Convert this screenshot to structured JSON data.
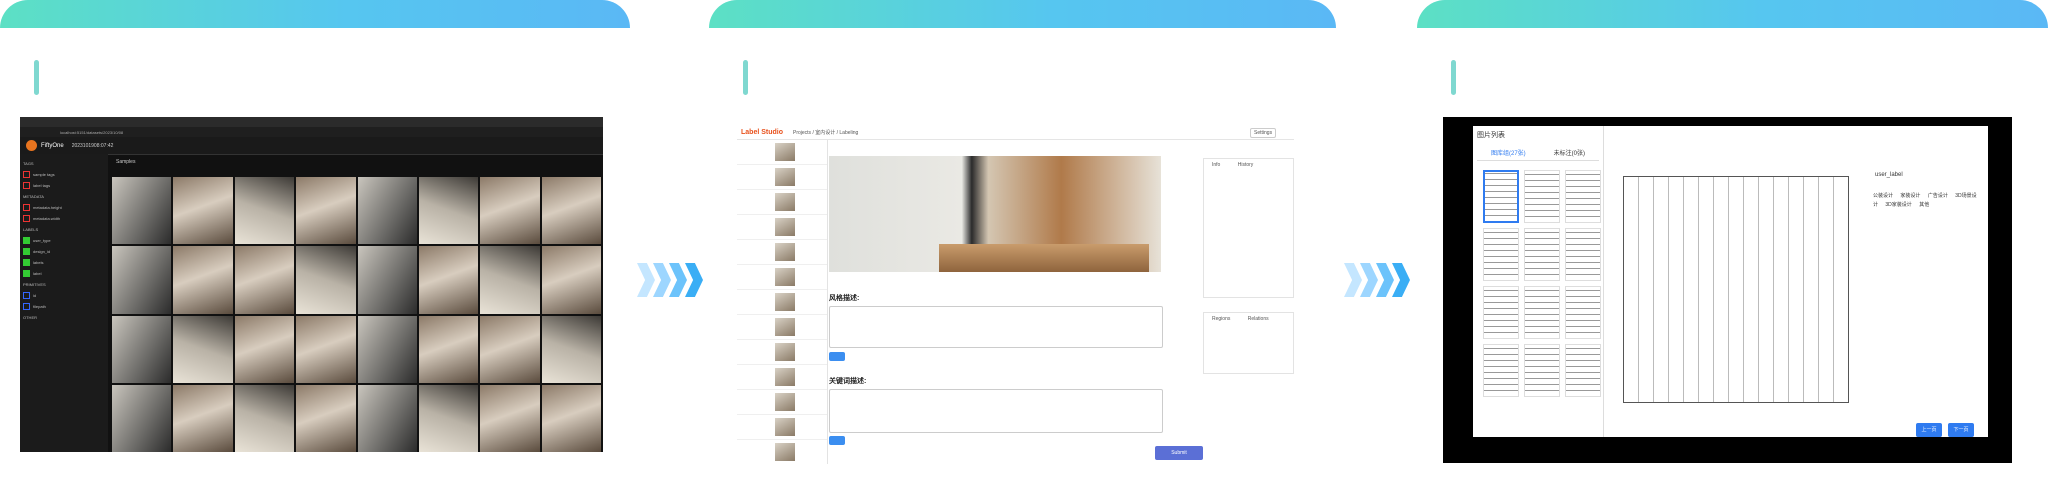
{
  "panel1": {
    "url": "localhost:5151/datasets/2023/10/08",
    "app_name": "FiftyOne",
    "dataset": "2023101908:07:42",
    "sidebar_sections": [
      "TAGS",
      "METADATA",
      "LABELS",
      "PRIMITIVES",
      "OTHER"
    ],
    "sidebar_fields": [
      "sample tags",
      "label tags",
      "metadata.height",
      "metadata.width",
      "user_type",
      "design_id",
      "labels",
      "label",
      "id",
      "filepath"
    ],
    "grid_tab": "Samples"
  },
  "panel2": {
    "app_name": "Label Studio",
    "breadcrumb": "Projects / 室内设计 / Labeling",
    "settings": "Settings",
    "section1": "风格描述:",
    "section2": "关键词描述:",
    "submit": "Submit",
    "right_tabs": [
      "Info",
      "History"
    ],
    "right_tabs2": [
      "Regions",
      "Relations"
    ]
  },
  "panel3": {
    "title": "图片列表",
    "tabs": [
      "图库组(27张)",
      "未标注(0张)"
    ],
    "field_label": "user_label",
    "options": [
      "公装设计",
      "家装设计",
      "广告设计",
      "3D场景设计",
      "3D家装设计",
      "其他"
    ],
    "prev": "上一页",
    "next": "下一页"
  }
}
